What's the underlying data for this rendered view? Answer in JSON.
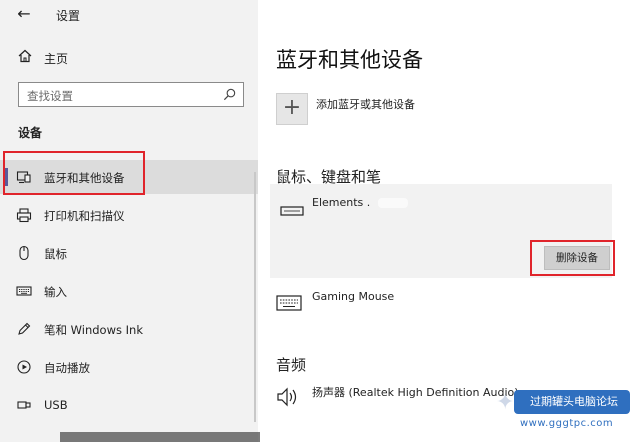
{
  "window": {
    "title": "设置",
    "controls": {
      "minimize": "—",
      "maximize": "☐",
      "close": "✕"
    }
  },
  "nav": {
    "back_glyph": "←",
    "home_label": "主页",
    "search_placeholder": "查找设置",
    "section_label": "设备",
    "items": [
      {
        "label": "蓝牙和其他设备",
        "icon": "bluetooth-devices-icon",
        "active": true
      },
      {
        "label": "打印机和扫描仪",
        "icon": "printer-icon",
        "active": false
      },
      {
        "label": "鼠标",
        "icon": "mouse-icon",
        "active": false
      },
      {
        "label": "输入",
        "icon": "keyboard-icon",
        "active": false
      },
      {
        "label": "笔和 Windows Ink",
        "icon": "pen-icon",
        "active": false
      },
      {
        "label": "自动播放",
        "icon": "autoplay-icon",
        "active": false
      },
      {
        "label": "USB",
        "icon": "usb-icon",
        "active": false
      }
    ]
  },
  "main": {
    "title": "蓝牙和其他设备",
    "add_device_label": "添加蓝牙或其他设备",
    "groups": {
      "mouse_keyboard_pen": {
        "heading": "鼠标、键盘和笔",
        "selected_device": {
          "name": "Elements .",
          "remove_label": "删除设备"
        },
        "devices": [
          {
            "name": "Gaming Mouse"
          }
        ]
      },
      "audio": {
        "heading": "音频",
        "devices": [
          {
            "name": "扬声器 (Realtek High Definition Audio)"
          }
        ]
      }
    }
  },
  "watermark": {
    "text": "过期罐头电脑论坛",
    "url": "www.gggtpc.com"
  },
  "colors": {
    "accent": "#5a5a9a",
    "highlight_box": "#e0242b",
    "nav_bg": "#f2f2f2",
    "watermark_blue": "#2f6fbf"
  }
}
